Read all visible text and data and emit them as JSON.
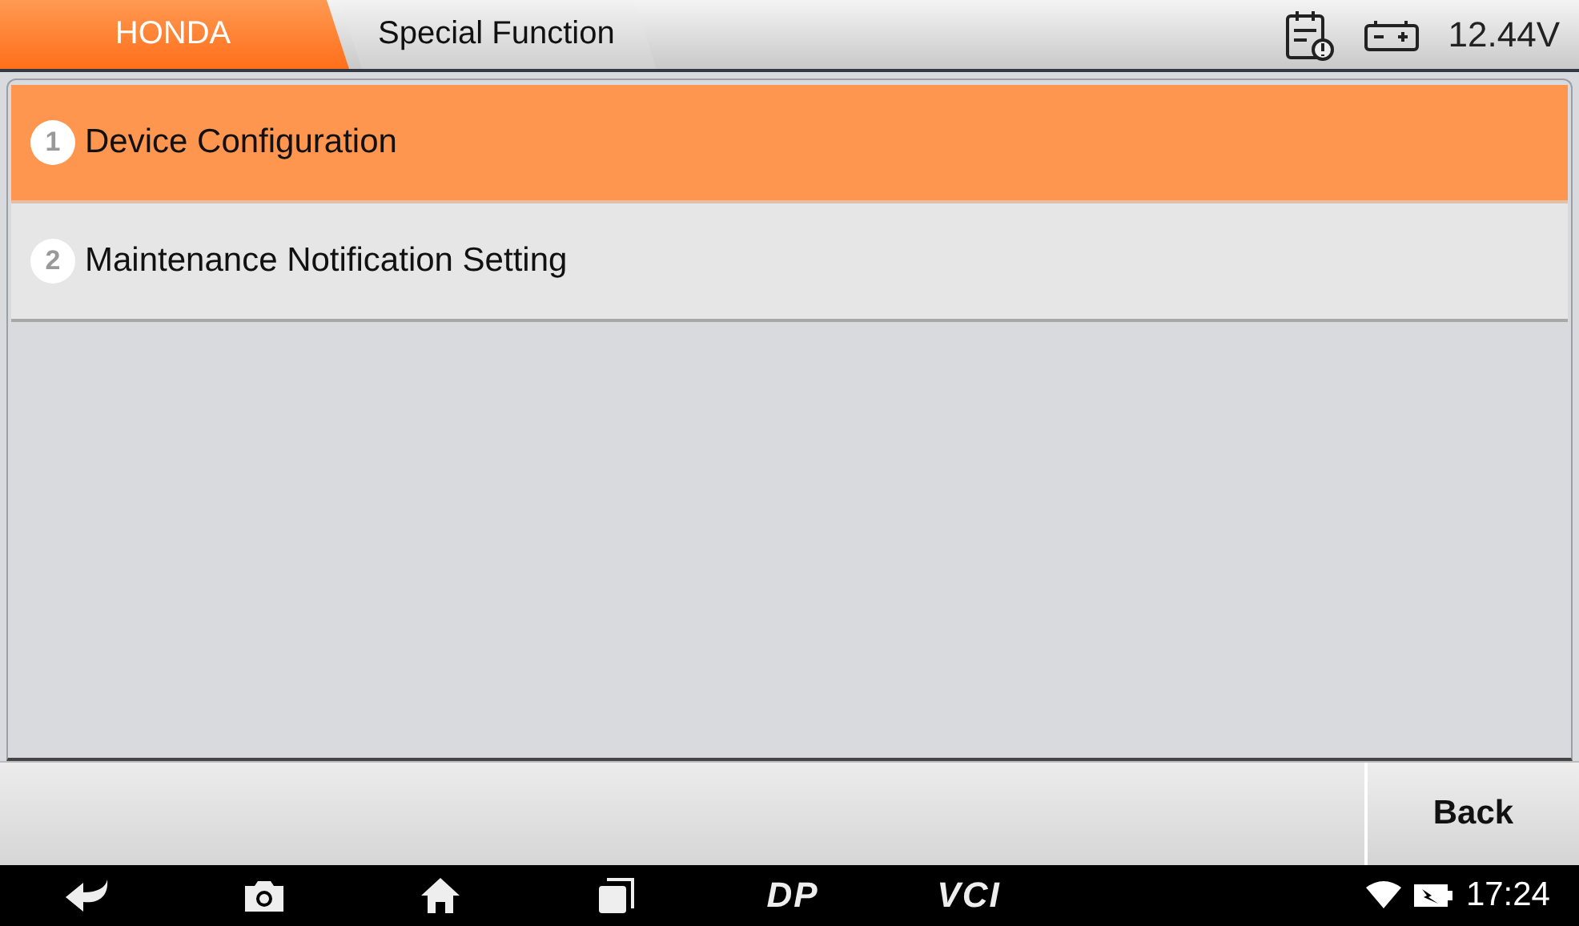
{
  "breadcrumbs": [
    {
      "label": "HONDA",
      "selected": true
    },
    {
      "label": "Special Function",
      "selected": false
    }
  ],
  "status": {
    "voltage": "12.44V"
  },
  "menu": [
    {
      "number": "1",
      "label": "Device Configuration",
      "selected": true
    },
    {
      "number": "2",
      "label": "Maintenance Notification Setting",
      "selected": false
    }
  ],
  "buttons": [
    "Back"
  ],
  "navbar": {
    "labels": [
      "DP",
      "VCI"
    ],
    "time": "17:24"
  }
}
